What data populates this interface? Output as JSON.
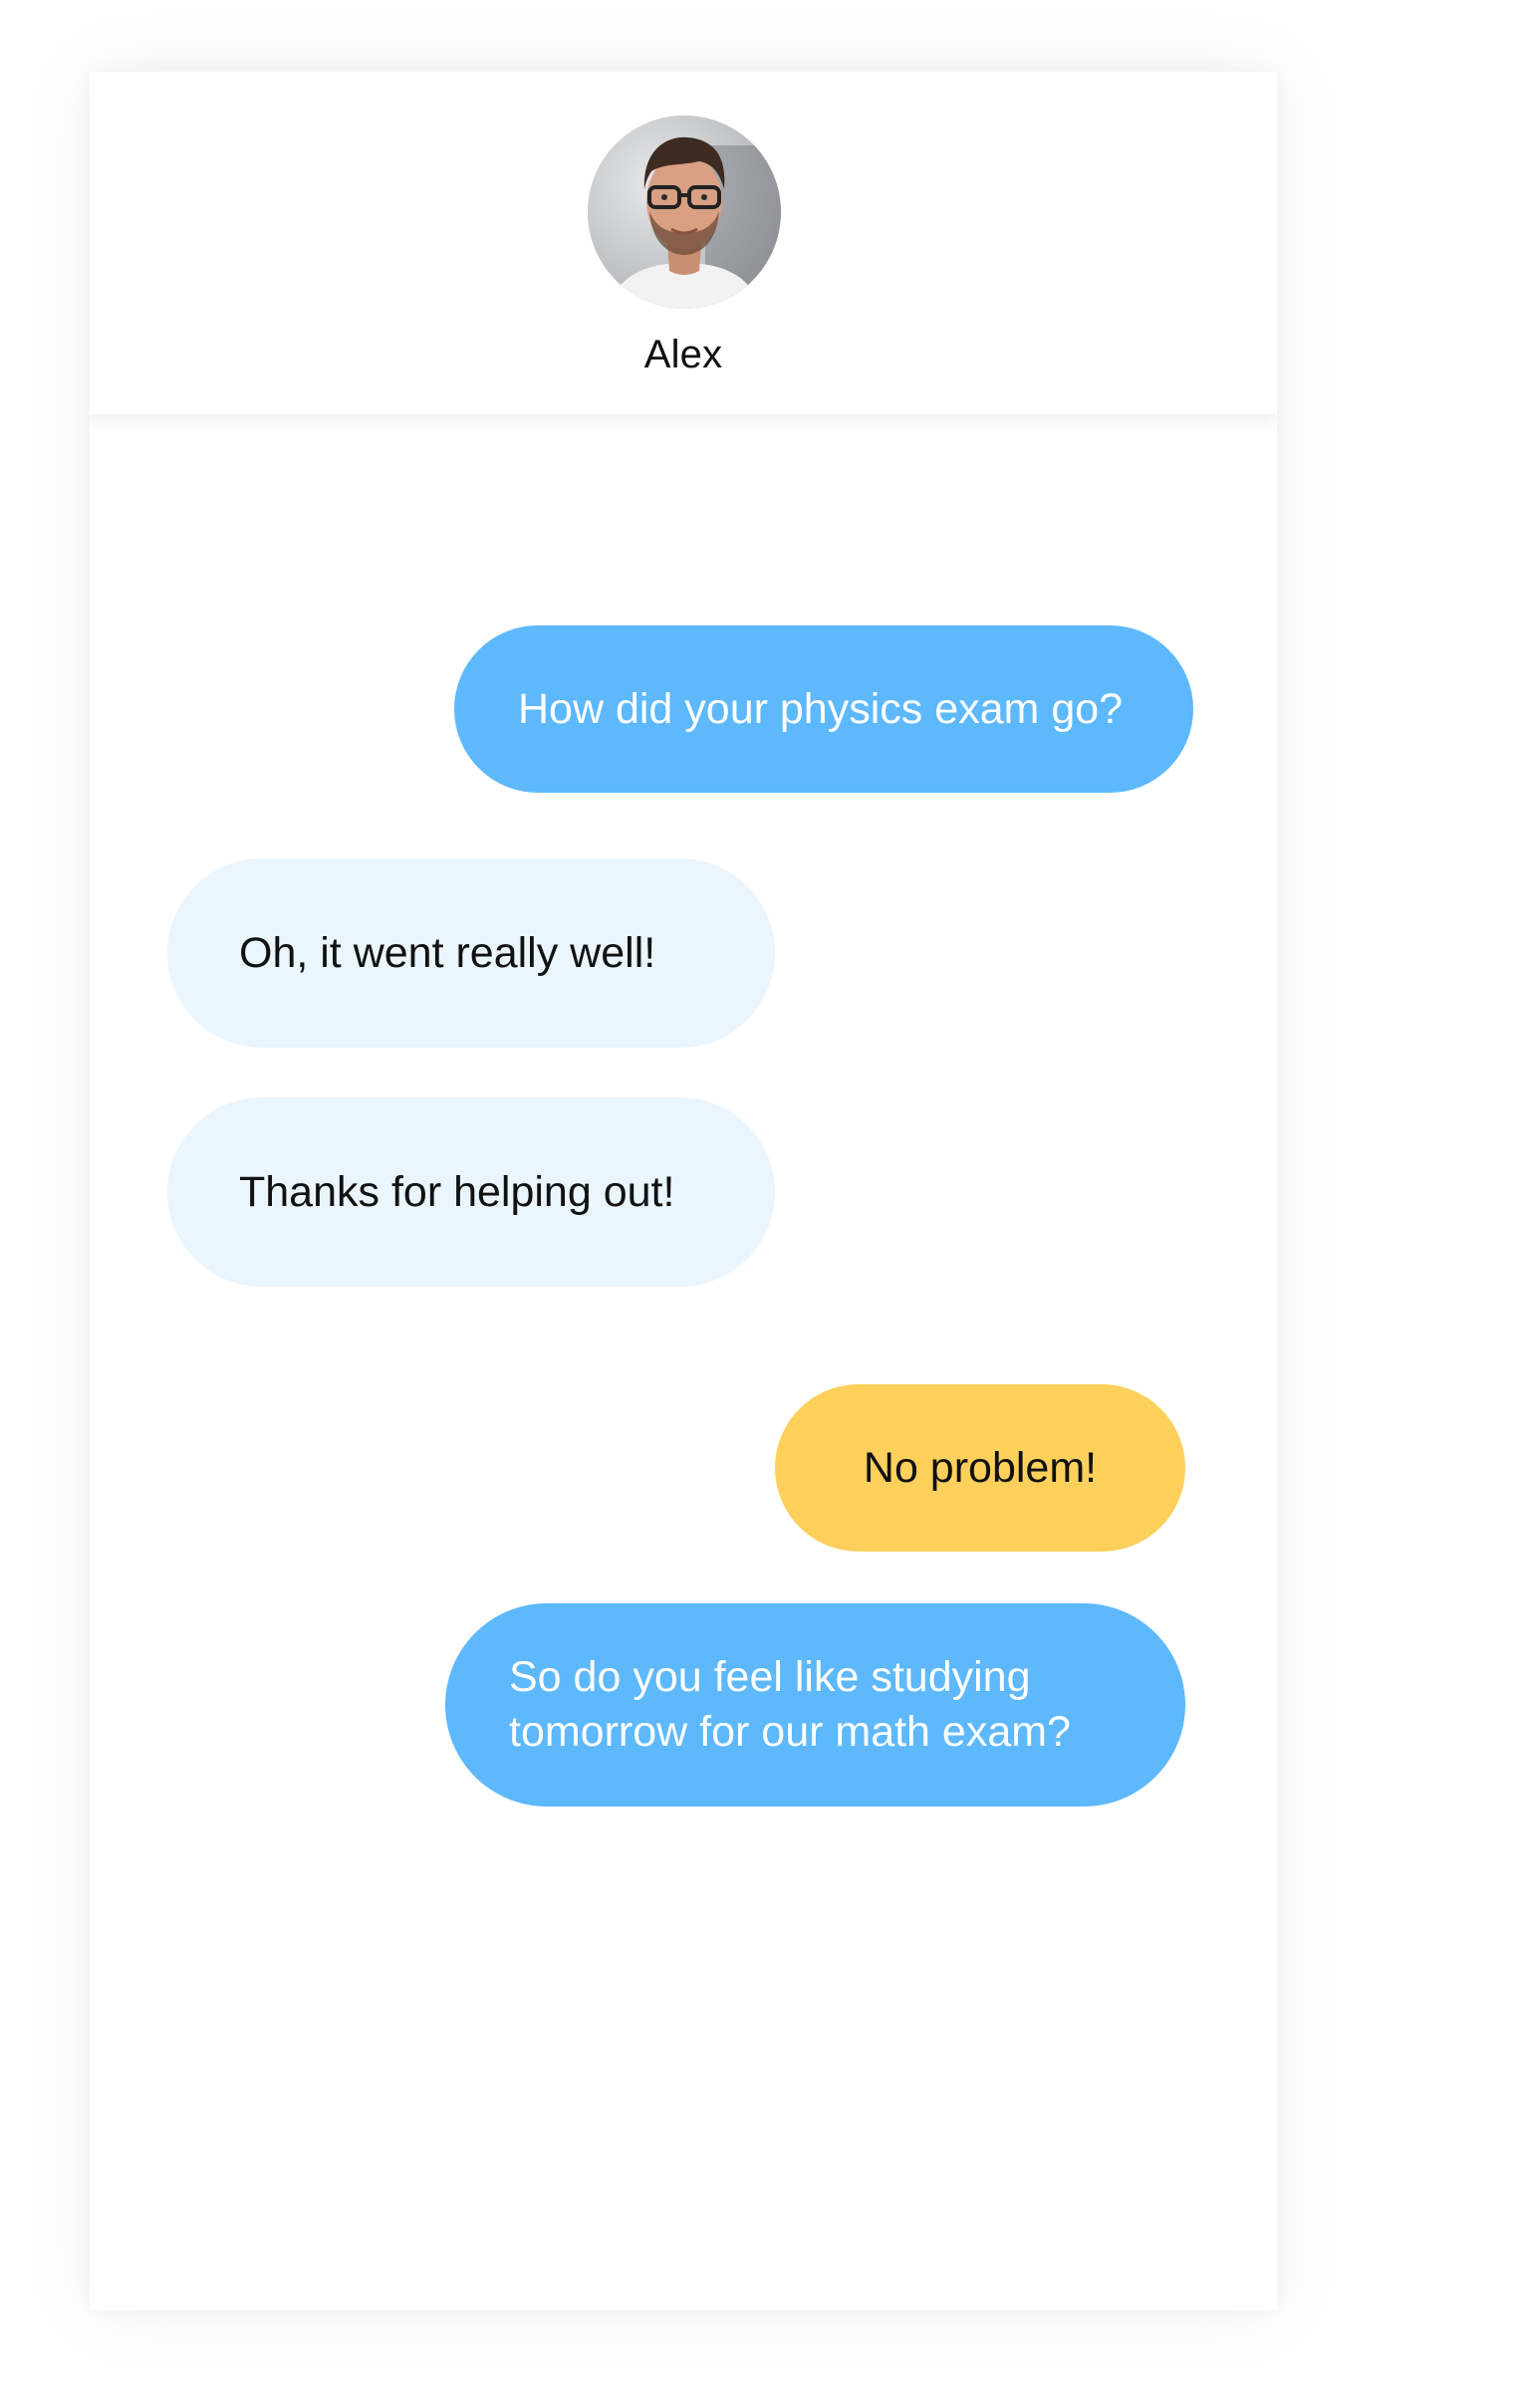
{
  "contact": {
    "name": "Alex",
    "avatar": "profile-photo"
  },
  "colors": {
    "outgoing": "#5db8fc",
    "incoming": "#eaf5fe",
    "highlight": "#fdd05c"
  },
  "messages": [
    {
      "sender": "me",
      "style": "outgoing",
      "lines": [
        "How did your physics exam go?"
      ]
    },
    {
      "sender": "contact",
      "style": "incoming",
      "lines": [
        "Oh, it went really well!"
      ]
    },
    {
      "sender": "contact",
      "style": "incoming",
      "lines": [
        "Thanks for helping out!"
      ]
    },
    {
      "sender": "me",
      "style": "highlight",
      "lines": [
        "No problem!"
      ]
    },
    {
      "sender": "me",
      "style": "outgoing",
      "lines": [
        "So do you feel like studying",
        "tomorrow for our math exam?"
      ]
    }
  ]
}
